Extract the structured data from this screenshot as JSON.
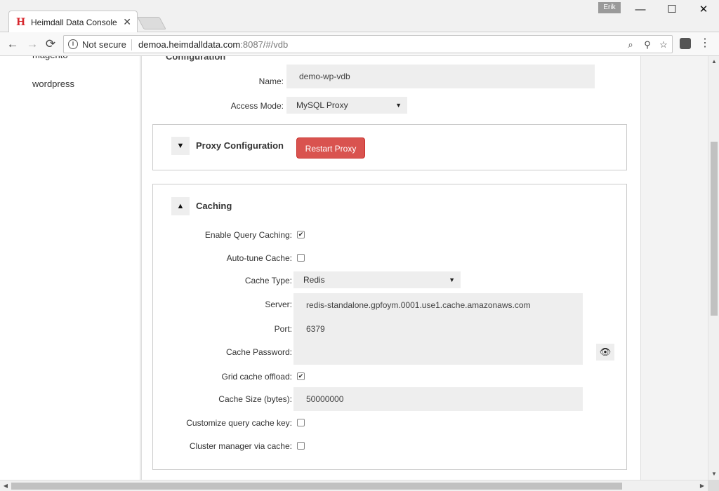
{
  "browser": {
    "tab_title": "Heimdall Data Console",
    "tab_close": "✕",
    "favicon_letter": "H",
    "profile_name": "Erik",
    "security_label": "Not secure",
    "url_host": "demoa.heimdalldata.com",
    "url_rest": ":8087/#/vdb",
    "window_controls": {
      "minimize": "—",
      "maximize": "☐",
      "close": "✕"
    },
    "nav": {
      "back": "←",
      "forward": "→",
      "reload": "⟳"
    },
    "icons": {
      "zoom": "⌕",
      "key": "⚲",
      "star": "☆",
      "menu": "⋮"
    }
  },
  "sidebar": {
    "items": [
      {
        "label": "magento"
      },
      {
        "label": "wordpress"
      }
    ]
  },
  "main": {
    "section_title": "Configuration",
    "name_label": "Name:",
    "name_value": "demo-wp-vdb",
    "access_mode_label": "Access Mode:",
    "access_mode_value": "MySQL Proxy"
  },
  "proxy": {
    "title": "Proxy Configuration",
    "toggle": "▼",
    "restart_label": "Restart Proxy",
    "accent_color": "#d9534f"
  },
  "caching": {
    "title": "Caching",
    "toggle": "▲",
    "enable_label": "Enable Query Caching:",
    "enable_checked": true,
    "autotune_label": "Auto-tune Cache:",
    "autotune_checked": false,
    "cache_type_label": "Cache Type:",
    "cache_type_value": "Redis",
    "server_label": "Server:",
    "server_value": "redis-standalone.gpfoym.0001.use1.cache.amazonaws.com",
    "port_label": "Port:",
    "port_value": "6379",
    "password_label": "Cache Password:",
    "password_value": "",
    "grid_label": "Grid cache offload:",
    "grid_checked": true,
    "size_label": "Cache Size (bytes):",
    "size_value": "50000000",
    "custom_key_label": "Customize query cache key:",
    "custom_key_checked": false,
    "cluster_label": "Cluster manager via cache:",
    "cluster_checked": false,
    "checkmark": "✔",
    "eye_icon": "👁",
    "select_arrow": "▼"
  }
}
